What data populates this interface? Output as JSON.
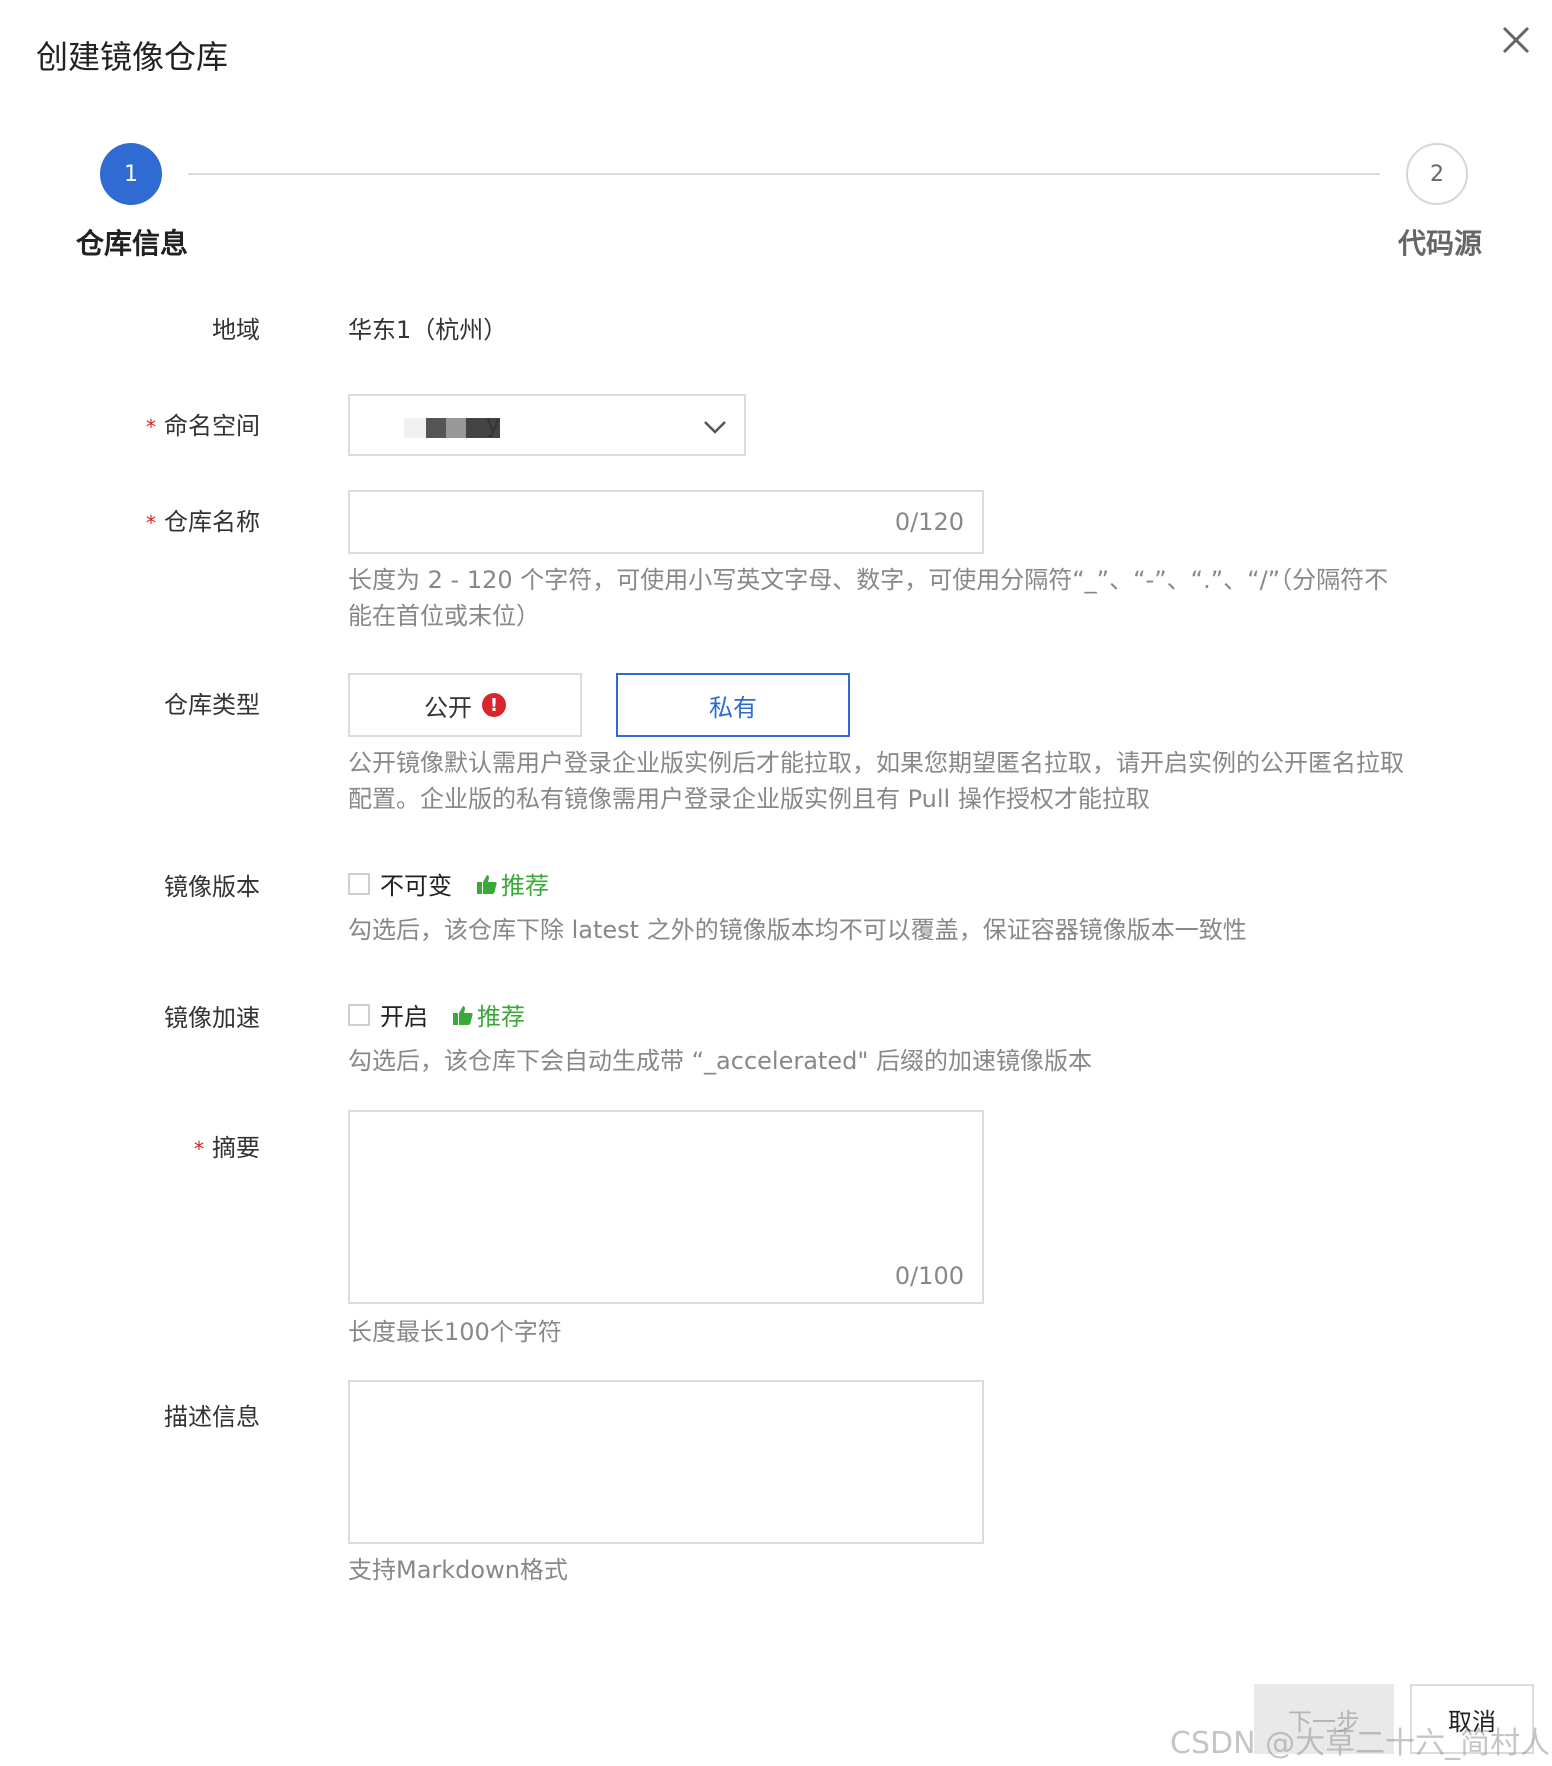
{
  "dialog": {
    "title": "创建镜像仓库"
  },
  "steps": [
    {
      "number": "1",
      "label": "仓库信息",
      "active": true
    },
    {
      "number": "2",
      "label": "代码源",
      "active": false
    }
  ],
  "form": {
    "region": {
      "label": "地域",
      "value": "华东1（杭州）"
    },
    "namespace": {
      "label": "命名空间",
      "required_mark": "*",
      "value_visible_suffix": "y"
    },
    "repo_name": {
      "label": "仓库名称",
      "required_mark": "*",
      "value": "",
      "counter": "0/120",
      "hint": "长度为 2 - 120 个字符，可使用小写英文字母、数字，可使用分隔符“_”、“-”、“.”、“/”（分隔符不能在首位或末位）"
    },
    "repo_type": {
      "label": "仓库类型",
      "options": [
        "公开",
        "私有"
      ],
      "selected": "私有",
      "warning_glyph": "!",
      "hint": "公开镜像默认需用户登录企业版实例后才能拉取，如果您期望匿名拉取，请开启实例的公开匿名拉取配置。企业版的私有镜像需用户登录企业版实例且有 Pull 操作授权才能拉取"
    },
    "image_version": {
      "label": "镜像版本",
      "checkbox_label": "不可变",
      "checked": false,
      "recommend": "推荐",
      "hint": "勾选后，该仓库下除 latest 之外的镜像版本均不可以覆盖，保证容器镜像版本一致性"
    },
    "image_accel": {
      "label": "镜像加速",
      "checkbox_label": "开启",
      "checked": false,
      "recommend": "推荐",
      "hint": "勾选后，该仓库下会自动生成带 “_accelerated\" 后缀的加速镜像版本"
    },
    "summary": {
      "label": "摘要",
      "required_mark": "*",
      "value": "",
      "counter": "0/100",
      "hint": "长度最长100个字符"
    },
    "description": {
      "label": "描述信息",
      "value": "",
      "hint": "支持Markdown格式"
    }
  },
  "footer": {
    "next_label": "下一步",
    "cancel_label": "取消"
  },
  "watermark": "CSDN @大草二十六_简村人",
  "colors": {
    "primary": "#2f6bd2",
    "required": "#e02020",
    "recommend": "#3aa93a",
    "warning": "#d9262c",
    "hint": "#888888"
  }
}
